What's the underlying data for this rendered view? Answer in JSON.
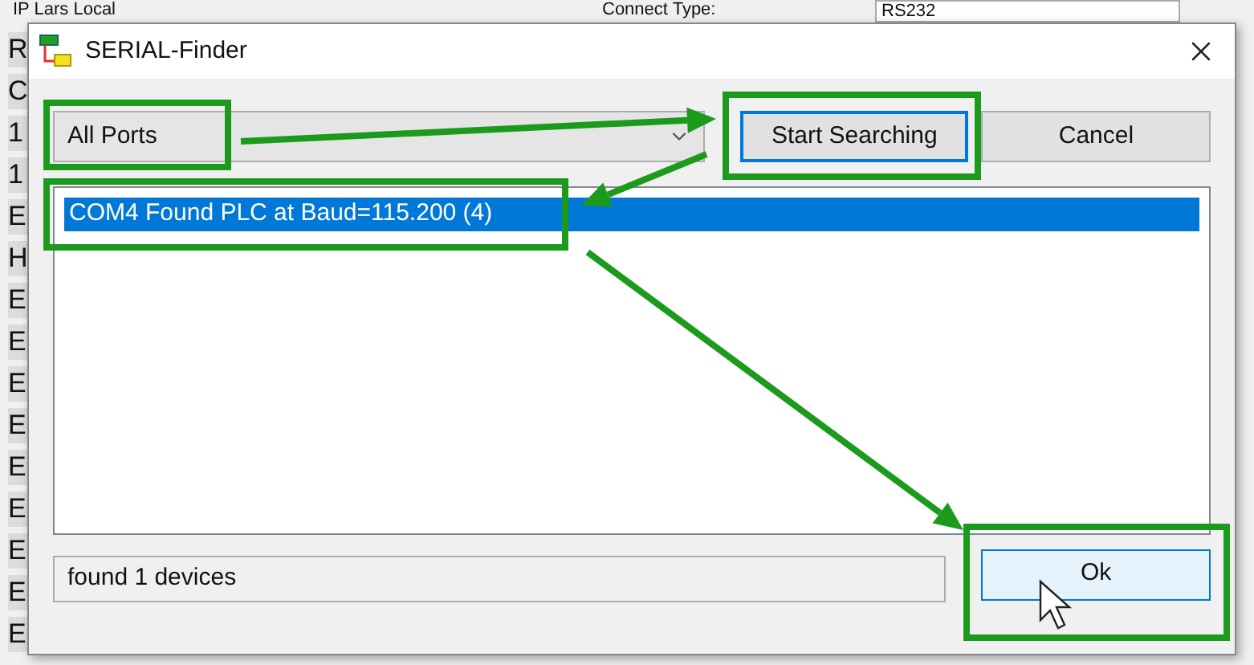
{
  "background_window": {
    "title_row": "IP Lars Local",
    "left_column": [
      "R",
      "C",
      "1",
      "1",
      "E",
      "H",
      "E",
      "E",
      "E",
      "E",
      "E",
      "E",
      "E",
      "E",
      "E"
    ],
    "connect_type_label": "Connect Type:",
    "connect_type_value": "RS232"
  },
  "dialog": {
    "title": "SERIAL-Finder",
    "port_select": "All Ports",
    "buttons": [
      {
        "label": "Start Searching",
        "focused": true
      },
      {
        "label": "Cancel",
        "focused": false
      }
    ],
    "results": [
      {
        "text": "COM4 Found PLC at Baud=115.200 (4)",
        "selected": true
      }
    ],
    "status": "found 1 devices",
    "ok_button": {
      "label": "Ok",
      "hovered": true
    }
  }
}
